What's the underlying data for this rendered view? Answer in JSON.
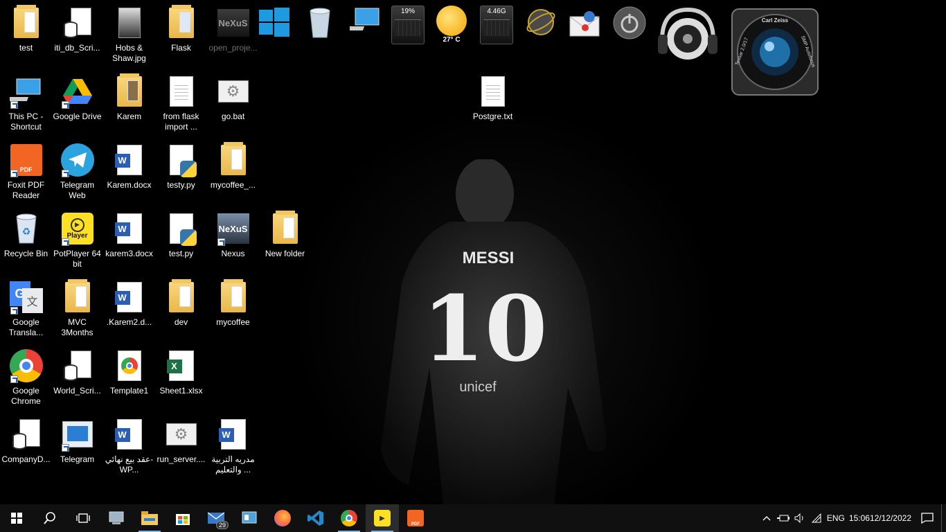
{
  "desktop": {
    "gadgets": {
      "cpu_meter": "19%",
      "weather_temp": "27° C",
      "memory_meter": "4.46G",
      "camera_brand": "Carl Zeiss",
      "camera_lens": "Tessar 2.0/17",
      "camera_focus": "SMP Autofocus"
    },
    "col1": [
      "test",
      "iti_db_Scri...",
      "Hobs & Shaw.jpg",
      "Flask",
      "open_proje..."
    ],
    "row2": [
      "This PC - Shortcut",
      "Google Drive",
      "Karem",
      "from flask import ...",
      "go.bat"
    ],
    "postgre": "Postgre.txt",
    "row3": [
      "Foxit PDF Reader",
      "Telegram Web",
      "Karem.docx",
      "testy.py",
      "mycoffee_..."
    ],
    "row4": [
      "Recycle Bin",
      "PotPlayer 64 bit",
      "karem3.docx",
      "test.py",
      "Nexus",
      "New folder"
    ],
    "row5": [
      "Google Transla...",
      "MVC 3Months",
      ".Karem2.d...",
      "dev",
      "mycoffee"
    ],
    "row6": [
      "Google Chrome",
      "World_Scri...",
      "Template1",
      "Sheet1.xlsx"
    ],
    "row7": [
      "CompanyD...",
      "Telegram",
      "عقد بيع نهائي-WP...",
      "run_server....",
      "مدريه التربية والتعليم ..."
    ],
    "nexus_logo": "NeXuS",
    "potplayer_text": "Player"
  },
  "wallpaper": {
    "jersey_name": "MESSI",
    "jersey_number": "10",
    "sponsor": "unicef"
  },
  "taskbar": {
    "mail_badge": "29",
    "language": "ENG",
    "time": "15:06",
    "date": "12/12/2022"
  },
  "colors": {
    "taskbar_bg": "#101010",
    "accent": "#76b9ed",
    "folder": "#f2c760"
  }
}
